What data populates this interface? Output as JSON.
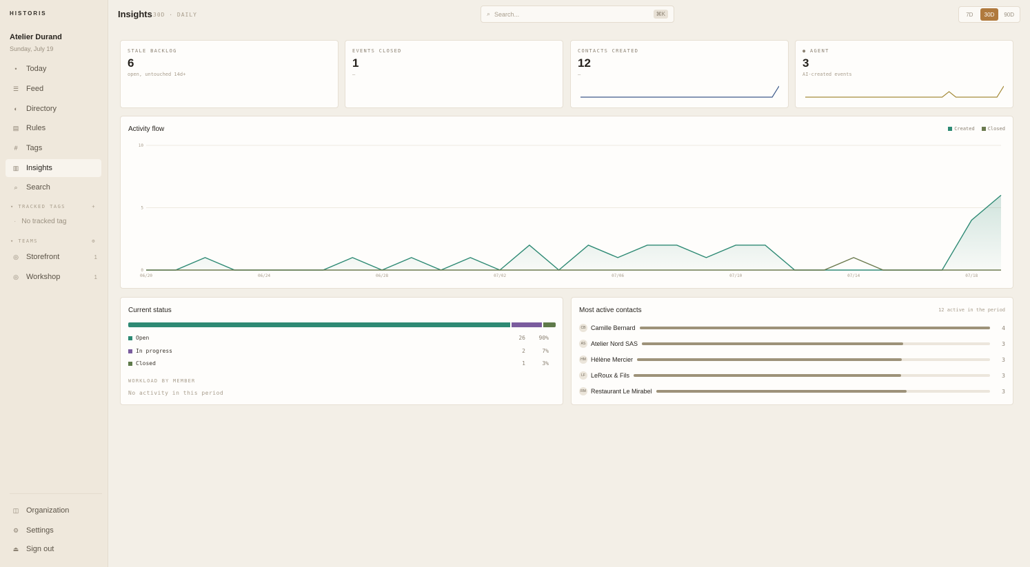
{
  "app": {
    "brand": "HISTORIS"
  },
  "sidebar": {
    "org_name": "Atelier Durand",
    "date": "Sunday, July 19",
    "nav": [
      {
        "label": "Today",
        "icon": "dot-icon"
      },
      {
        "label": "Feed",
        "icon": "feed-icon"
      },
      {
        "label": "Directory",
        "icon": "directory-icon"
      },
      {
        "label": "Rules",
        "icon": "rules-icon"
      },
      {
        "label": "Tags",
        "icon": "hash-icon"
      },
      {
        "label": "Insights",
        "icon": "insights-icon",
        "active": true
      },
      {
        "label": "Search",
        "icon": "search-icon"
      }
    ],
    "tracked_tags_label": "▾ TRACKED TAGS",
    "tracked_tags_empty": "No tracked tag",
    "teams_label": "▾ TEAMS",
    "teams": [
      {
        "label": "Storefront",
        "count": "1"
      },
      {
        "label": "Workshop",
        "count": "1"
      }
    ],
    "footer": [
      {
        "label": "Organization",
        "icon": "organization-icon"
      },
      {
        "label": "Settings",
        "icon": "settings-icon"
      },
      {
        "label": "Sign out",
        "icon": "sign-out-icon"
      }
    ]
  },
  "header": {
    "title": "Insights",
    "meta": "30D · DAILY",
    "search_placeholder": "Search...",
    "search_shortcut": "⌘K",
    "ranges": [
      "7D",
      "30D",
      "90D"
    ],
    "active_range": "30D"
  },
  "kpis": [
    {
      "label": "STALE BACKLOG",
      "value": "6",
      "sub": "open, untouched 14d+"
    },
    {
      "label": "EVENTS CLOSED",
      "value": "1",
      "sub": "—"
    },
    {
      "label": "CONTACTS CREATED",
      "value": "12",
      "sub": "—"
    },
    {
      "label": "● AGENT",
      "value": "3",
      "sub": "AI-created events"
    }
  ],
  "activity": {
    "title": "Activity flow",
    "legend": [
      {
        "name": "Created",
        "color": "#2e8a74"
      },
      {
        "name": "Closed",
        "color": "#6b7a4e"
      }
    ]
  },
  "chart_data": {
    "type": "area",
    "x": [
      "06/20",
      "06/21",
      "06/22",
      "06/23",
      "06/24",
      "06/25",
      "06/26",
      "06/27",
      "06/28",
      "06/29",
      "06/30",
      "07/01",
      "07/02",
      "07/03",
      "07/04",
      "07/05",
      "07/06",
      "07/07",
      "07/08",
      "07/09",
      "07/10",
      "07/11",
      "07/12",
      "07/13",
      "07/14",
      "07/15",
      "07/16",
      "07/17",
      "07/18",
      "07/19"
    ],
    "tick_labels": [
      "06/20",
      "06/24",
      "06/28",
      "07/02",
      "07/06",
      "07/10",
      "07/14",
      "07/18"
    ],
    "series": [
      {
        "name": "Created",
        "color": "#2e8a74",
        "values": [
          0,
          0,
          1,
          0,
          0,
          0,
          0,
          1,
          0,
          1,
          0,
          1,
          0,
          2,
          0,
          2,
          1,
          2,
          2,
          1,
          2,
          2,
          0,
          0,
          0,
          0,
          0,
          0,
          4,
          6
        ]
      },
      {
        "name": "Closed",
        "color": "#6b7a4e",
        "values": [
          0,
          0,
          0,
          0,
          0,
          0,
          0,
          0,
          0,
          0,
          0,
          0,
          0,
          0,
          0,
          0,
          0,
          0,
          0,
          0,
          0,
          0,
          0,
          0,
          1,
          0,
          0,
          0,
          0,
          0
        ]
      }
    ],
    "ylim": [
      0,
      10
    ],
    "yticks": [
      0,
      5,
      10
    ],
    "grid": true,
    "legend_position": "top-right"
  },
  "sparklines": {
    "contacts_created": {
      "color": "#3d5a8a",
      "values": [
        0,
        0,
        0,
        0,
        0,
        0,
        0,
        0,
        0,
        0,
        0,
        0,
        0,
        0,
        0,
        0,
        0,
        0,
        0,
        0,
        0,
        0,
        0,
        0,
        0,
        0,
        0,
        0,
        0,
        1
      ]
    },
    "agent": {
      "color": "#a58b3a",
      "values": [
        0,
        0,
        0,
        0,
        0,
        0,
        0,
        0,
        0,
        0,
        0,
        0,
        0,
        0,
        0,
        0,
        0,
        0,
        0,
        0,
        0,
        1,
        0,
        0,
        0,
        0,
        0,
        0,
        0,
        2
      ]
    }
  },
  "status": {
    "title": "Current status",
    "rows": [
      {
        "label": "Open",
        "count": "26",
        "pct": "90%",
        "fraction": 0.9,
        "color": "#2e8a74"
      },
      {
        "label": "In progress",
        "count": "2",
        "pct": "7%",
        "fraction": 0.07,
        "color": "#7a5c9e"
      },
      {
        "label": "Closed",
        "count": "1",
        "pct": "3%",
        "fraction": 0.03,
        "color": "#5f7a4a"
      }
    ],
    "workload_label": "WORKLOAD BY MEMBER",
    "workload_empty": "No activity in this period"
  },
  "contacts": {
    "title": "Most active contacts",
    "subtitle": "12 active in the period",
    "rows": [
      {
        "initials": "CB",
        "name": "Camille Bernard",
        "value": "4",
        "fraction": 1.0
      },
      {
        "initials": "AS",
        "name": "Atelier Nord SAS",
        "value": "3",
        "fraction": 0.75
      },
      {
        "initials": "HM",
        "name": "Hélène Mercier",
        "value": "3",
        "fraction": 0.75
      },
      {
        "initials": "LF",
        "name": "LeRoux & Fils",
        "value": "3",
        "fraction": 0.75
      },
      {
        "initials": "RM",
        "name": "Restaurant Le Mirabel",
        "value": "3",
        "fraction": 0.75
      }
    ]
  }
}
